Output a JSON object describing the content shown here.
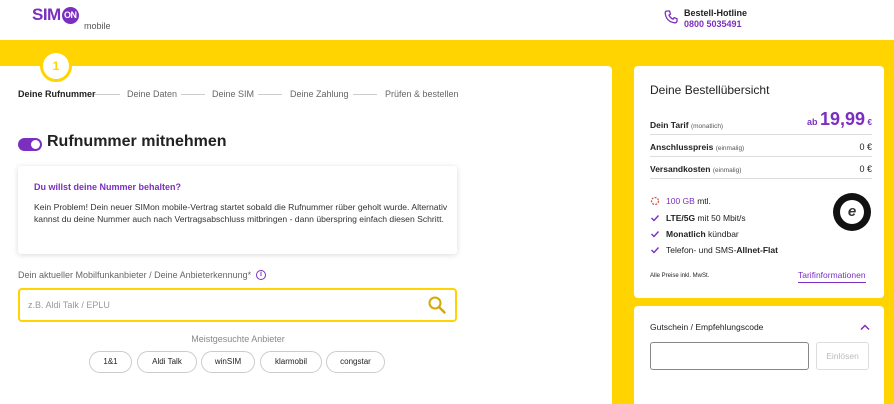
{
  "header": {
    "logo_sim": "SIM",
    "logo_on": "ON",
    "logo_mobile": "mobile",
    "hotline_label": "Bestell-Hotline",
    "hotline_number": "0800 5035491"
  },
  "stepper": {
    "current_step": "1",
    "steps": [
      {
        "label": "Deine Rufnummer",
        "active": true
      },
      {
        "label": "Deine Daten",
        "active": false
      },
      {
        "label": "Deine SIM",
        "active": false
      },
      {
        "label": "Deine Zahlung",
        "active": false
      },
      {
        "label": "Prüfen & bestellen",
        "active": false
      }
    ]
  },
  "section": {
    "title": "Rufnummer mitnehmen"
  },
  "info_box": {
    "question": "Du willst deine Nummer behalten?",
    "text": "Kein Problem! Dein neuer SIMon mobile-Vertrag startet sobald die Rufnummer rüber geholt wurde. Alternativ kannst du deine Nummer auch nach Vertragsabschluss mitbringen - dann überspring einfach diesen Schritt."
  },
  "provider_field": {
    "label": "Dein aktueller Mobilfunkanbieter / Deine Anbieterkennung*",
    "value": "",
    "placeholder": "z.B. Aldi Talk / EPLU"
  },
  "popular": {
    "label": "Meistgesuchte Anbieter",
    "providers": [
      "1&1",
      "Aldi Talk",
      "winSIM",
      "klarmobil",
      "congstar"
    ]
  },
  "summary": {
    "title": "Deine Bestellübersicht",
    "tarif_label": "Dein Tarif",
    "tarif_note": "(monatlich)",
    "tarif_prefix": "ab",
    "tarif_price": "19,99",
    "tarif_currency": "€",
    "anschluss_label": "Anschlusspreis",
    "anschluss_note": "(einmalig)",
    "anschluss_value": "0 €",
    "versand_label": "Versandkosten",
    "versand_note": "(einmalig)",
    "versand_value": "0 €",
    "features": {
      "data_amount": "100 GB",
      "data_suffix": " mtl.",
      "lte_bold": "LTE/5G",
      "lte_rest": " mit 50 Mbit/s",
      "monthly_bold": "Monatlich",
      "monthly_rest": " kündbar",
      "allnet_pre": "Telefon- und SMS-",
      "allnet_bold": "Allnet-Flat"
    },
    "prices_note": "Alle Preise inkl. MwSt.",
    "tarif_info_link": "Tarifinformationen"
  },
  "voucher": {
    "title": "Gutschein / Empfehlungscode",
    "value": "",
    "button": "Einlösen"
  },
  "colors": {
    "accent_purple": "#7b2fbf",
    "brand_yellow": "#ffd400"
  },
  "icons": {
    "hotline": "phone-icon",
    "search": "search-icon",
    "info": "info-icon",
    "data": "data-icon",
    "check": "check-icon",
    "collapse": "chevron-up-icon",
    "seal": "trusted-shops-seal"
  }
}
